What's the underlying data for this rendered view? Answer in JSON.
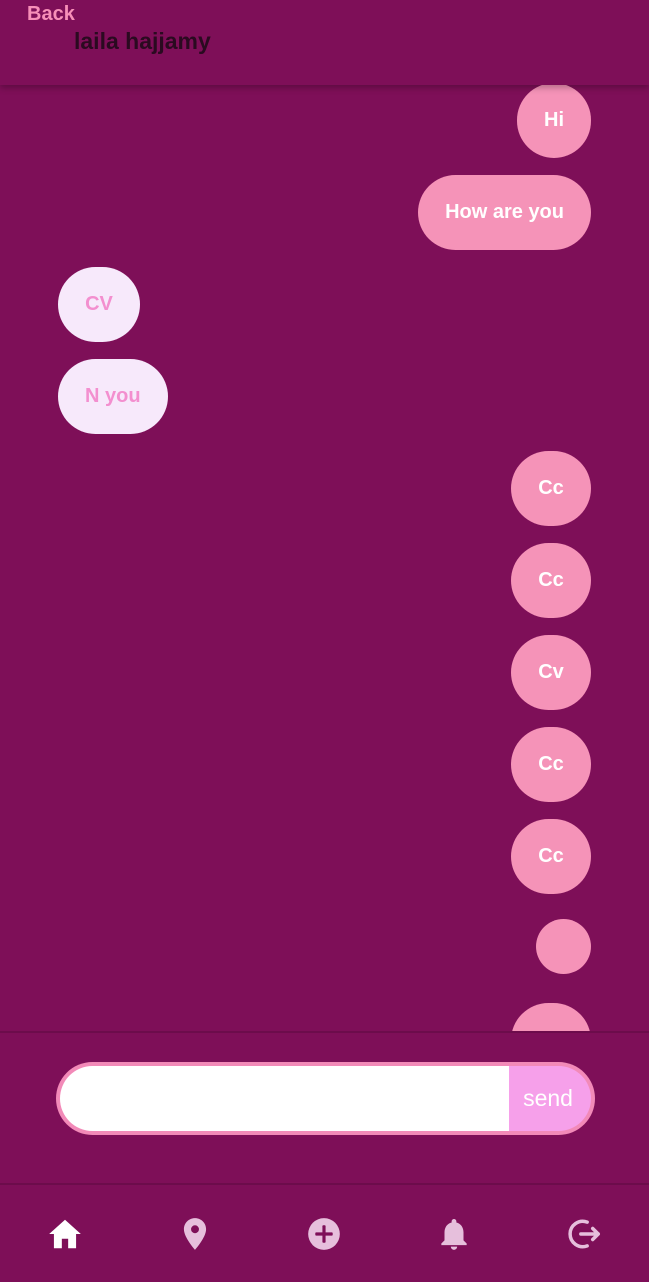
{
  "header": {
    "back_label": "Back",
    "contact_name": "laila hajjamy"
  },
  "messages": [
    {
      "text": "Hi",
      "direction": "sent"
    },
    {
      "text": "How are you",
      "direction": "sent"
    },
    {
      "text": "CV",
      "direction": "received"
    },
    {
      "text": "N you",
      "direction": "received"
    },
    {
      "text": "Cc",
      "direction": "sent"
    },
    {
      "text": "Cc",
      "direction": "sent"
    },
    {
      "text": "Cv",
      "direction": "sent"
    },
    {
      "text": "Cc",
      "direction": "sent"
    },
    {
      "text": "Cc",
      "direction": "sent"
    },
    {
      "text": "",
      "direction": "sent"
    },
    {
      "text": "",
      "direction": "sent"
    }
  ],
  "composer": {
    "value": "",
    "placeholder": "",
    "send_label": "send"
  },
  "nav": {
    "items": [
      {
        "icon": "home-icon",
        "active": true
      },
      {
        "icon": "location-pin-icon",
        "active": false
      },
      {
        "icon": "add-circle-icon",
        "active": false
      },
      {
        "icon": "bell-icon",
        "active": false
      },
      {
        "icon": "logout-icon",
        "active": false
      }
    ]
  },
  "colors": {
    "background": "#7e0f58",
    "sent_bubble": "#f593b8",
    "received_bubble": "#f7e9fb",
    "accent": "#f78fb8",
    "send_button": "#f6a0ea"
  }
}
